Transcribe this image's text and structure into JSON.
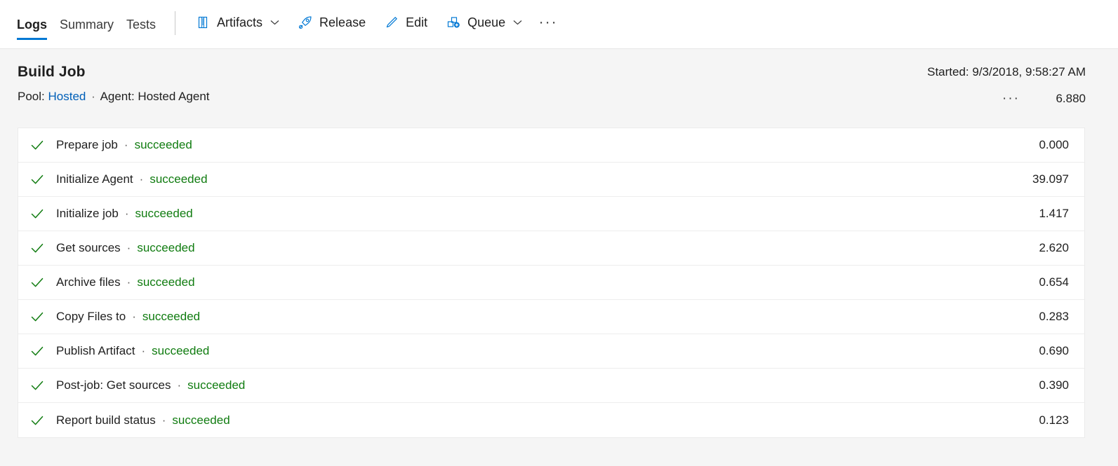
{
  "toolbar": {
    "tabs": [
      {
        "label": "Logs",
        "active": true
      },
      {
        "label": "Summary",
        "active": false
      },
      {
        "label": "Tests",
        "active": false
      }
    ],
    "commands": [
      {
        "label": "Artifacts",
        "icon": "artifacts-package-icon",
        "has_chevron": true
      },
      {
        "label": "Release",
        "icon": "rocket-icon",
        "has_chevron": false
      },
      {
        "label": "Edit",
        "icon": "pencil-icon",
        "has_chevron": false
      },
      {
        "label": "Queue",
        "icon": "queue-add-icon",
        "has_chevron": true
      }
    ],
    "overflow_label": "···"
  },
  "job": {
    "title": "Build Job",
    "pool_label": "Pool:",
    "pool_value": "Hosted",
    "separator": "·",
    "agent_label": "Agent: Hosted Agent",
    "started": "Started: 9/3/2018, 9:58:27 AM",
    "more_label": "···",
    "duration": "6.880"
  },
  "tasks": {
    "status_separator": "·",
    "rows": [
      {
        "name": "Prepare job",
        "status": "succeeded",
        "duration": "0.000"
      },
      {
        "name": "Initialize Agent",
        "status": "succeeded",
        "duration": "39.097"
      },
      {
        "name": "Initialize job",
        "status": "succeeded",
        "duration": "1.417"
      },
      {
        "name": "Get sources",
        "status": "succeeded",
        "duration": "2.620"
      },
      {
        "name": "Archive files",
        "status": "succeeded",
        "duration": "0.654"
      },
      {
        "name": "Copy Files to",
        "status": "succeeded",
        "duration": "0.283"
      },
      {
        "name": "Publish Artifact",
        "status": "succeeded",
        "duration": "0.690"
      },
      {
        "name": "Post-job: Get sources",
        "status": "succeeded",
        "duration": "0.390"
      },
      {
        "name": "Report build status",
        "status": "succeeded",
        "duration": "0.123"
      }
    ]
  },
  "colors": {
    "accent": "#0078d4",
    "link": "#005fb8",
    "success": "#107c10",
    "page_bg": "#f5f5f5",
    "panel_bg": "#ffffff"
  }
}
